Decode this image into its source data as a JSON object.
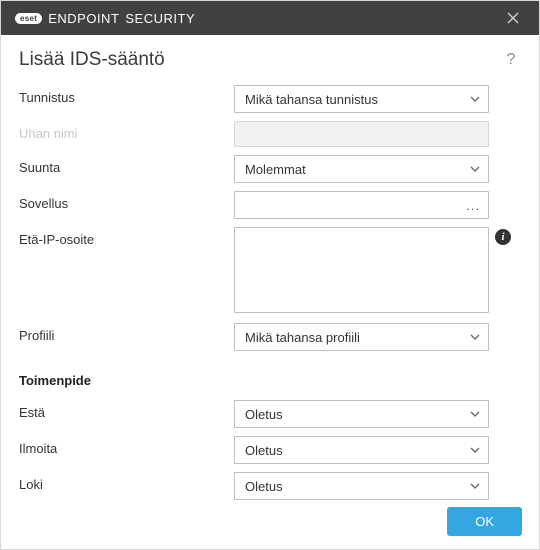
{
  "titlebar": {
    "badge": "eset",
    "product1": "ENDPOINT",
    "product2": "SECURITY"
  },
  "header": {
    "title": "Lisää IDS-sääntö",
    "help": "?"
  },
  "labels": {
    "tunnistus": "Tunnistus",
    "uhan_nimi": "Uhan nimi",
    "suunta": "Suunta",
    "sovellus": "Sovellus",
    "eta_ip": "Etä-IP-osoite",
    "profiili": "Profiili",
    "toimenpide": "Toimenpide",
    "esta": "Estä",
    "ilmoita": "Ilmoita",
    "loki": "Loki"
  },
  "values": {
    "tunnistus": "Mikä tahansa tunnistus",
    "uhan_nimi": "",
    "suunta": "Molemmat",
    "sovellus": "",
    "eta_ip": "",
    "profiili": "Mikä tahansa profiili",
    "esta": "Oletus",
    "ilmoita": "Oletus",
    "loki": "Oletus"
  },
  "footer": {
    "ok": "OK"
  },
  "icons": {
    "picker_dots": "...",
    "info": "i"
  }
}
